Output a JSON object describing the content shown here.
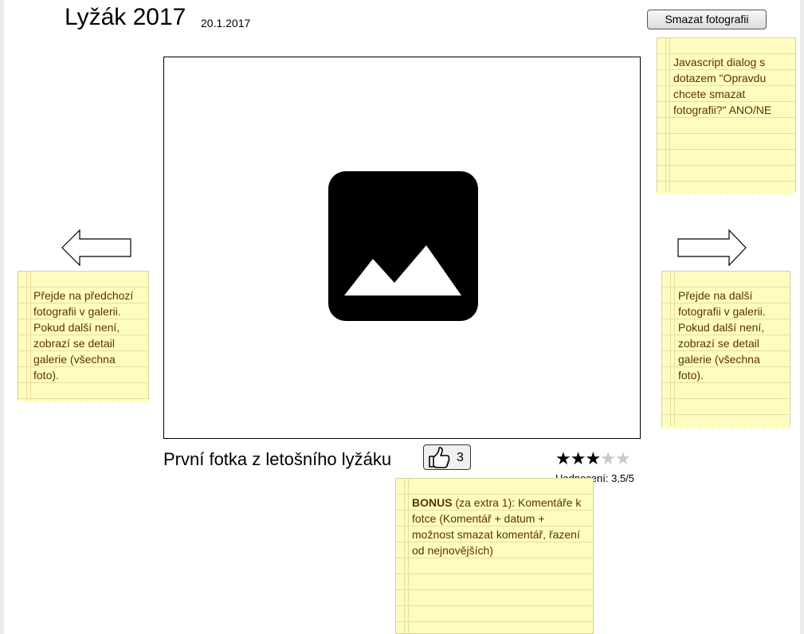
{
  "header": {
    "title": "Lyžák 2017",
    "date": "20.1.2017"
  },
  "toolbar": {
    "delete_label": "Smazat fotografii"
  },
  "photo": {
    "placeholder_icon": "image-placeholder-icon",
    "caption": "První fotka z letošního lyžáku"
  },
  "nav": {
    "prev_icon": "arrow-left-icon",
    "next_icon": "arrow-right-icon"
  },
  "like": {
    "icon": "thumbs-up-icon",
    "count": "3"
  },
  "rating": {
    "stars_total": 5,
    "stars_filled": 3,
    "label": "Hodnocení: 3,5/5"
  },
  "notes": {
    "dialog": "Javascript dialog s dotazem \"Opravdu chcete smazat fotografii?\" ANO/NE",
    "prev": "Přejde na předchozí fotografii v galerii. Pokud další není, zobrazí se detail galerie (všechna foto).",
    "next": "Přejde na další fotografii v galerii. Pokud další není, zobrazí se detail galerie (všechna foto).",
    "bonus_title": "BONUS",
    "bonus_text": " (za extra 1): Komentáře k fotce (Komentář + datum + možnost smazat komentář, řazení od nejnovějších)"
  },
  "colors": {
    "note_background": "#fffcc0",
    "note_text": "#5a3200",
    "star_filled": "#000000",
    "star_empty": "#c8c8c8"
  }
}
